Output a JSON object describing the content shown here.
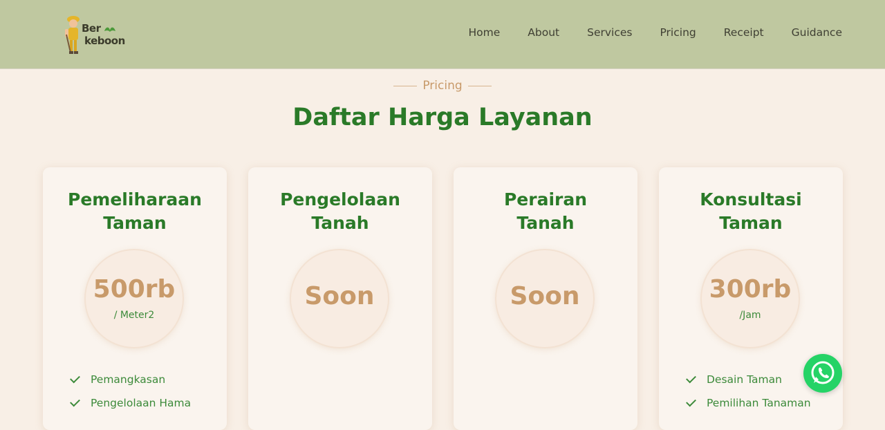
{
  "brand": {
    "line1": "Ber",
    "line2": "keboon"
  },
  "nav": [
    "Home",
    "About",
    "Services",
    "Pricing",
    "Receipt",
    "Guidance"
  ],
  "section": {
    "eyebrow": "Pricing",
    "title": "Daftar Harga Layanan"
  },
  "cards": [
    {
      "title_line1": "Pemeliharaan",
      "title_line2": "Taman",
      "price": "500rb",
      "unit": "/ Meter2",
      "features": [
        "Pemangkasan",
        "Pengelolaan Hama"
      ]
    },
    {
      "title_line1": "Pengelolaan",
      "title_line2": "Tanah",
      "price": "Soon",
      "unit": "",
      "features": []
    },
    {
      "title_line1": "Perairan",
      "title_line2": "Tanah",
      "price": "Soon",
      "unit": "",
      "features": []
    },
    {
      "title_line1": "Konsultasi",
      "title_line2": "Taman",
      "price": "300rb",
      "unit": "/Jam",
      "features": [
        "Desain Taman",
        "Pemilihan Tanaman"
      ]
    }
  ],
  "colors": {
    "header_bg": "#bfc8a0",
    "page_bg": "#f8efe6",
    "green": "#2a7a28",
    "accent": "#c89a6a",
    "whatsapp": "#25d366"
  },
  "icons": {
    "whatsapp": "whatsapp-icon",
    "check": "check-icon",
    "logo": "gardener-mascot-icon"
  }
}
